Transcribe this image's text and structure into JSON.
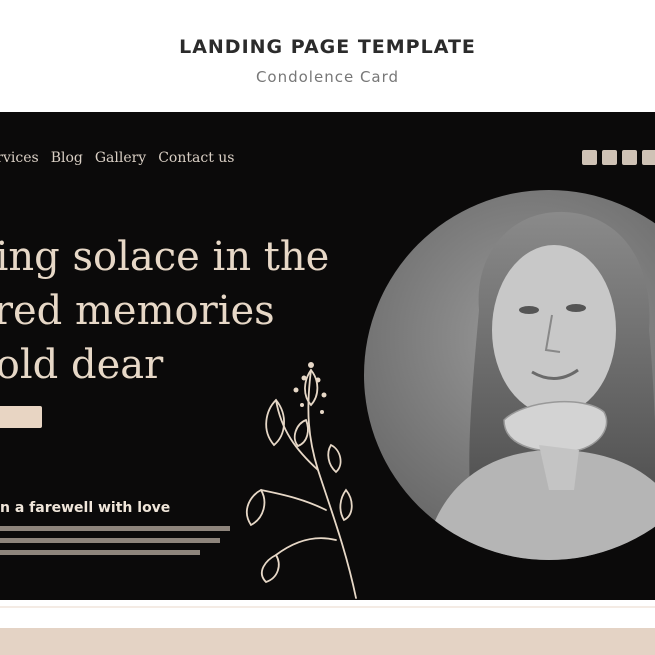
{
  "header": {
    "title": "LANDING PAGE TEMPLATE",
    "subtitle": "Condolence Card"
  },
  "hero": {
    "nav": [
      "ervices",
      "Blog",
      "Gallery",
      "Contact us"
    ],
    "headline": [
      "ding solace in the",
      "ared memories",
      "hold dear"
    ],
    "sub_heading": "n a farewell with love",
    "social_icons": [
      "social-icon-1",
      "social-icon-2",
      "social-icon-3",
      "social-icon-4"
    ],
    "portrait_desc": "grayscale portrait of an older woman"
  },
  "colors": {
    "background": "#0b0a0a",
    "accent": "#e8d5c3",
    "text_light": "#e7d8c7"
  }
}
